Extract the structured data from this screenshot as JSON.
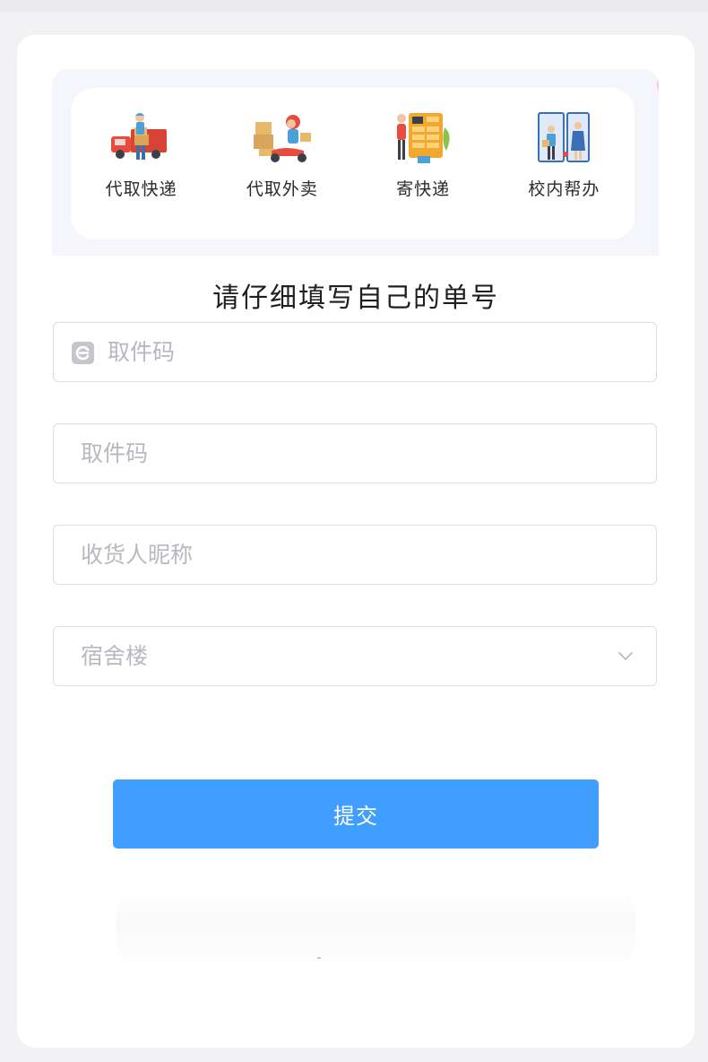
{
  "services": [
    {
      "label": "代取快递",
      "icon": "delivery-courier-icon"
    },
    {
      "label": "代取外卖",
      "icon": "food-delivery-scooter-icon"
    },
    {
      "label": "寄快递",
      "icon": "parcel-locker-icon"
    },
    {
      "label": "校内帮办",
      "icon": "campus-errand-icon"
    }
  ],
  "form": {
    "title": "请仔细填写自己的单号",
    "pickup_code_1_placeholder": "取件码",
    "pickup_code_2_placeholder": "取件码",
    "recipient_nickname_placeholder": "收货人昵称",
    "dormitory_placeholder": "宿舍楼",
    "submit_label": "提交"
  },
  "colors": {
    "primary": "#409eff",
    "page_background": "#f2f2f4",
    "panel_background": "#f5f6fb",
    "placeholder": "#b7b9bf",
    "border": "#dcdde1"
  }
}
